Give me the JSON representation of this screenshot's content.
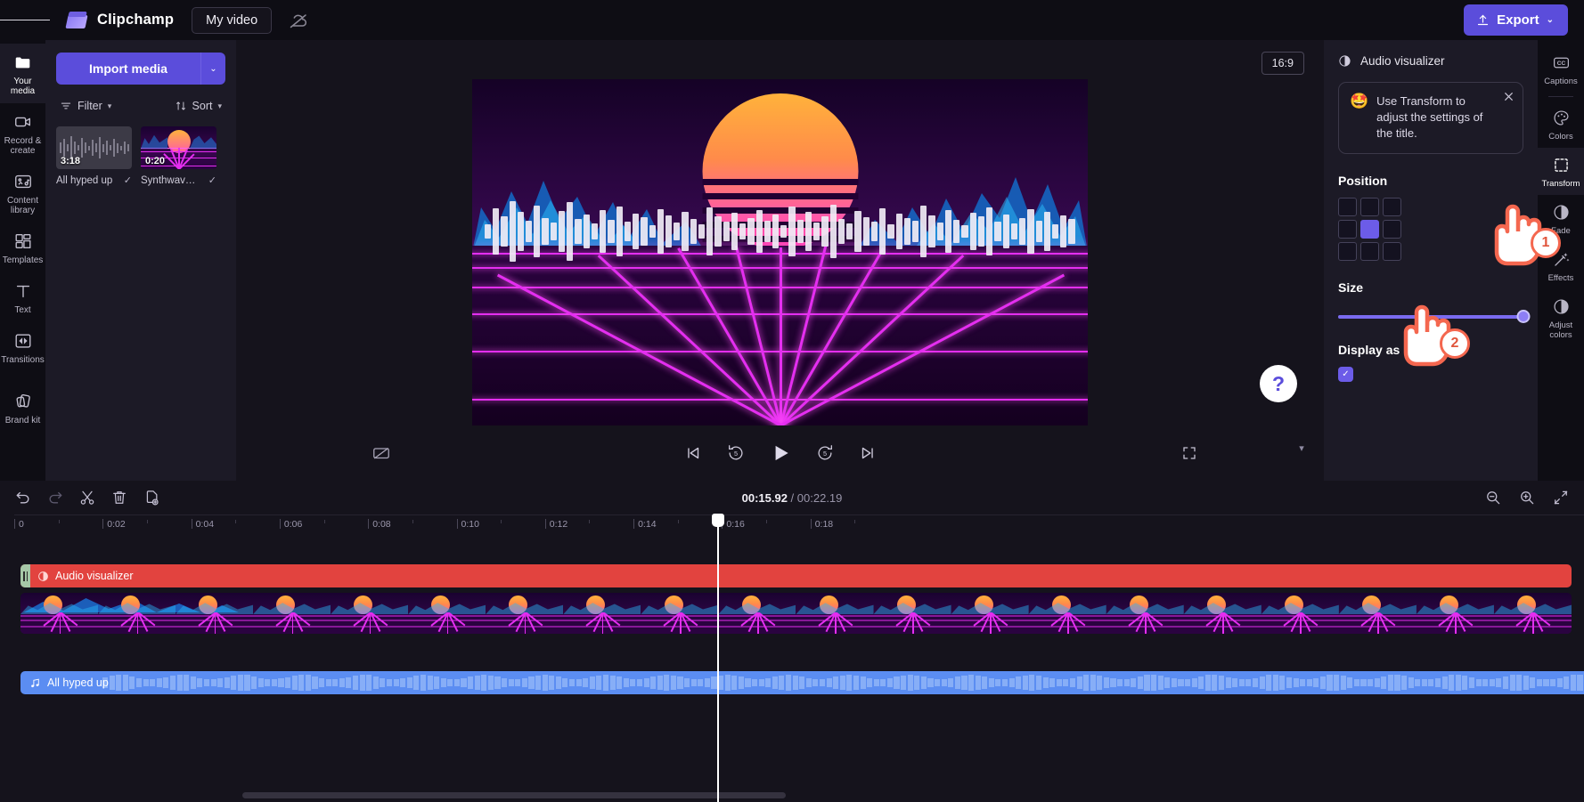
{
  "topbar": {
    "menu_icon": "hamburger-icon",
    "brand": "Clipchamp",
    "project_name": "My video",
    "cloud_icon": "cloud-off-icon",
    "export_label": "Export",
    "export_icon": "upload-icon",
    "export_caret": "⌄"
  },
  "rail": {
    "items": [
      {
        "label": "Your media",
        "icon": "folder-icon",
        "active": true
      },
      {
        "label": "Record & create",
        "icon": "video-camera-icon",
        "active": false
      },
      {
        "label": "Content library",
        "icon": "library-icon",
        "active": false
      },
      {
        "label": "Templates",
        "icon": "templates-icon",
        "active": false
      },
      {
        "label": "Text",
        "icon": "text-icon",
        "active": false
      },
      {
        "label": "Transitions",
        "icon": "transitions-icon",
        "active": false
      },
      {
        "label": "Brand kit",
        "icon": "brand-kit-icon",
        "active": false
      }
    ]
  },
  "media_panel": {
    "import_label": "Import media",
    "import_caret": "⌄",
    "filter_label": "Filter",
    "sort_label": "Sort",
    "items": [
      {
        "name": "All hyped up",
        "duration": "3:18",
        "type": "audio",
        "checked": "✓"
      },
      {
        "name": "Synthwave/ v...",
        "duration": "0:20",
        "type": "video",
        "checked": "✓"
      }
    ],
    "collapse_icon": "chevron-left-icon"
  },
  "preview": {
    "aspect_ratio": "16:9",
    "controls": {
      "skip_start": "skip-to-start-icon",
      "back5": "rewind-5-icon",
      "play": "play-icon",
      "fwd5": "forward-5-icon",
      "skip_end": "skip-to-end-icon",
      "captions_off": "captions-off-icon",
      "fullscreen": "fullscreen-icon"
    },
    "help_label": "?",
    "collapse_icon": "chevron-down-icon",
    "expand_icon": "chevron-right-icon"
  },
  "props": {
    "title": "Audio visualizer",
    "title_icon": "contrast-circle-icon",
    "tip": {
      "emoji": "🤩",
      "text": "Use Transform to adjust the settings of the title.",
      "close_icon": "close-icon"
    },
    "position_label": "Position",
    "position_selected_index": 4,
    "size_label": "Size",
    "size_value": 100,
    "display_as_bars_label": "Display as bars?",
    "display_as_bars_checked": true,
    "checkmark": "✓"
  },
  "toolrail": {
    "items": [
      {
        "label": "Captions",
        "icon": "closed-captions-icon",
        "active": false
      },
      {
        "label": "Colors",
        "icon": "palette-icon",
        "active": false
      },
      {
        "label": "Transform",
        "icon": "transform-icon",
        "active": true
      },
      {
        "label": "Fade",
        "icon": "fade-icon",
        "active": false
      },
      {
        "label": "Effects",
        "icon": "magic-wand-icon",
        "active": false
      },
      {
        "label": "Adjust colors",
        "icon": "adjust-colors-icon",
        "active": false
      }
    ]
  },
  "timeline": {
    "tools": [
      {
        "name": "undo",
        "icon": "undo-icon"
      },
      {
        "name": "redo",
        "icon": "redo-icon"
      },
      {
        "name": "split",
        "icon": "scissors-icon"
      },
      {
        "name": "delete",
        "icon": "trash-icon"
      },
      {
        "name": "duplicate",
        "icon": "duplicate-icon"
      }
    ],
    "current_time": "00:15.92",
    "separator": " / ",
    "total_time": "00:22.19",
    "zoom_out_icon": "zoom-out-icon",
    "zoom_in_icon": "zoom-in-icon",
    "fit_icon": "fit-to-screen-icon",
    "ruler_labels": [
      "0",
      "0:02",
      "0:04",
      "0:06",
      "0:08",
      "0:10",
      "0:12",
      "0:14",
      "0:16",
      "0:18"
    ],
    "playhead_time": "0:15.92",
    "clips": [
      {
        "name": "Audio visualizer",
        "type": "title",
        "icon": "contrast-circle-icon",
        "color": "#e2433f"
      },
      {
        "name": "Synthwave video",
        "type": "video",
        "color": "#1a0433"
      },
      {
        "name": "All hyped up",
        "type": "audio",
        "icon": "music-note-icon",
        "color": "#5b8df2"
      }
    ]
  },
  "callouts": [
    {
      "number": "1",
      "target": "transform-tool"
    },
    {
      "number": "2",
      "target": "display-as-bars-checkbox"
    }
  ],
  "colors": {
    "accent": "#5b4ddb",
    "accent_light": "#6c5ce8",
    "panel": "#1c1a26",
    "rail": "#0e0d14",
    "background": "#15131c",
    "clip_red": "#e2433f",
    "clip_blue": "#5b8df2",
    "callout": "#f4674f"
  }
}
